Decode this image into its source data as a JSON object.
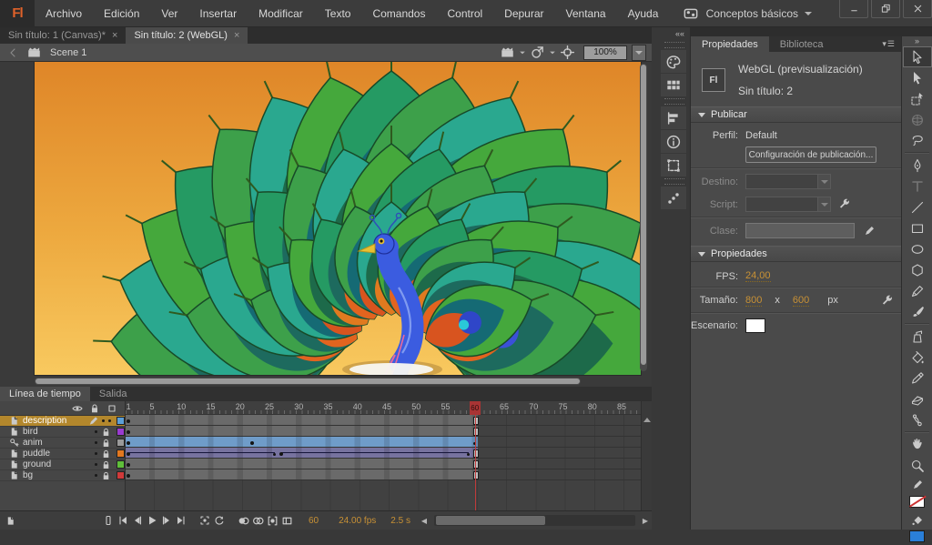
{
  "menubar": {
    "logo": "Fl",
    "items": [
      "Archivo",
      "Edición",
      "Ver",
      "Insertar",
      "Modificar",
      "Texto",
      "Comandos",
      "Control",
      "Depurar",
      "Ventana",
      "Ayuda"
    ],
    "workspace_label": "Conceptos básicos",
    "window_controls": [
      "minimize",
      "restore",
      "close"
    ]
  },
  "doc_tabs": [
    {
      "label": "Sin título: 1 (Canvas)*",
      "active": false
    },
    {
      "label": "Sin título: 2 (WebGL)",
      "active": true
    }
  ],
  "scene_bar": {
    "scene_label": "Scene 1",
    "zoom_value": "100%"
  },
  "dock_icons": [
    "color-panel",
    "swatches-panel",
    "align-panel",
    "info-panel",
    "transform-panel",
    "motion-presets-panel"
  ],
  "properties": {
    "tabs": [
      {
        "label": "Propiedades",
        "active": true
      },
      {
        "label": "Biblioteca",
        "active": false
      }
    ],
    "doc_type": "WebGL (previsualización)",
    "doc_name": "Sin título: 2",
    "badge": "Fl",
    "publish": {
      "section": "Publicar",
      "profile_label": "Perfil:",
      "profile_value": "Default",
      "settings_button": "Configuración de publicación...",
      "target_label": "Destino:",
      "script_label": "Script:",
      "class_label": "Clase:"
    },
    "props": {
      "section": "Propiedades",
      "fps_label": "FPS:",
      "fps_value": "24,00",
      "size_label": "Tamaño:",
      "size_w": "800",
      "size_x": "x",
      "size_h": "600",
      "size_unit": "px",
      "stage_label": "Escenario:",
      "stage_color": "#ffffff"
    }
  },
  "tools": [
    {
      "id": "selection",
      "state": "active"
    },
    {
      "id": "subselection",
      "state": "normal"
    },
    {
      "id": "free-transform",
      "state": "normal"
    },
    {
      "id": "rotation-3d",
      "state": "disabled"
    },
    {
      "id": "lasso",
      "state": "normal"
    },
    {
      "id": "divider",
      "state": ""
    },
    {
      "id": "pen",
      "state": "normal"
    },
    {
      "id": "text",
      "state": "disabled"
    },
    {
      "id": "line",
      "state": "normal"
    },
    {
      "id": "rectangle",
      "state": "normal"
    },
    {
      "id": "oval",
      "state": "normal"
    },
    {
      "id": "polystar",
      "state": "normal"
    },
    {
      "id": "pencil",
      "state": "normal"
    },
    {
      "id": "brush",
      "state": "normal"
    },
    {
      "id": "divider",
      "state": ""
    },
    {
      "id": "ink-bottle",
      "state": "normal"
    },
    {
      "id": "paint-bucket",
      "state": "normal"
    },
    {
      "id": "eyedropper",
      "state": "normal"
    },
    {
      "id": "eraser",
      "state": "normal"
    },
    {
      "id": "bone",
      "state": "normal"
    },
    {
      "id": "divider",
      "state": ""
    },
    {
      "id": "hand",
      "state": "normal"
    },
    {
      "id": "zoom",
      "state": "normal"
    }
  ],
  "swatches": {
    "stroke": "none",
    "fill": "#2a7fd8"
  },
  "timeline": {
    "tabs": [
      {
        "label": "Línea de tiempo",
        "active": true
      },
      {
        "label": "Salida",
        "active": false
      }
    ],
    "ruler_numbers": [
      1,
      5,
      10,
      15,
      20,
      25,
      30,
      35,
      40,
      45,
      50,
      55,
      60,
      65,
      70,
      75,
      80,
      85
    ],
    "playhead_frame": 60,
    "frame_width": 6.45,
    "layers": [
      {
        "name": "description",
        "color": "#5c9fd6",
        "selected": true,
        "locked": false,
        "kind": "normal",
        "row": {
          "type": "static",
          "end": 60
        }
      },
      {
        "name": "bird",
        "color": "#9a3bd0",
        "selected": false,
        "locked": true,
        "kind": "normal",
        "row": {
          "type": "static",
          "end": 60
        }
      },
      {
        "name": "anim",
        "color": "#9a9a9a",
        "selected": false,
        "locked": true,
        "kind": "guide",
        "row": {
          "type": "motion",
          "end": 60,
          "keys": [
            22
          ]
        }
      },
      {
        "name": "puddle",
        "color": "#e2781f",
        "selected": false,
        "locked": true,
        "kind": "normal",
        "row": {
          "type": "classic",
          "end": 60,
          "keys": [
            27
          ]
        }
      },
      {
        "name": "ground",
        "color": "#5fbf3a",
        "selected": false,
        "locked": true,
        "kind": "normal",
        "row": {
          "type": "static",
          "end": 60
        }
      },
      {
        "name": "bg",
        "color": "#d03a3a",
        "selected": false,
        "locked": true,
        "kind": "normal",
        "row": {
          "type": "static",
          "end": 60
        }
      }
    ],
    "controls": [
      "first-frame",
      "step-back",
      "play",
      "step-forward",
      "last-frame",
      "center-frame",
      "loop",
      "onion-skin",
      "onion-skin-outlines",
      "edit-multiple-frames",
      "modify-markers"
    ],
    "status": {
      "frame": "60",
      "fps": "24.00 fps",
      "time": "2.5 s"
    }
  },
  "colors": {
    "accent_orange": "#c89135",
    "tween_blue": "#6f9cc9",
    "classic_tween": "#77739f",
    "static_span": "#6a6a6a",
    "playhead_red": "#b23535",
    "selected_layer": "#b3872c"
  }
}
